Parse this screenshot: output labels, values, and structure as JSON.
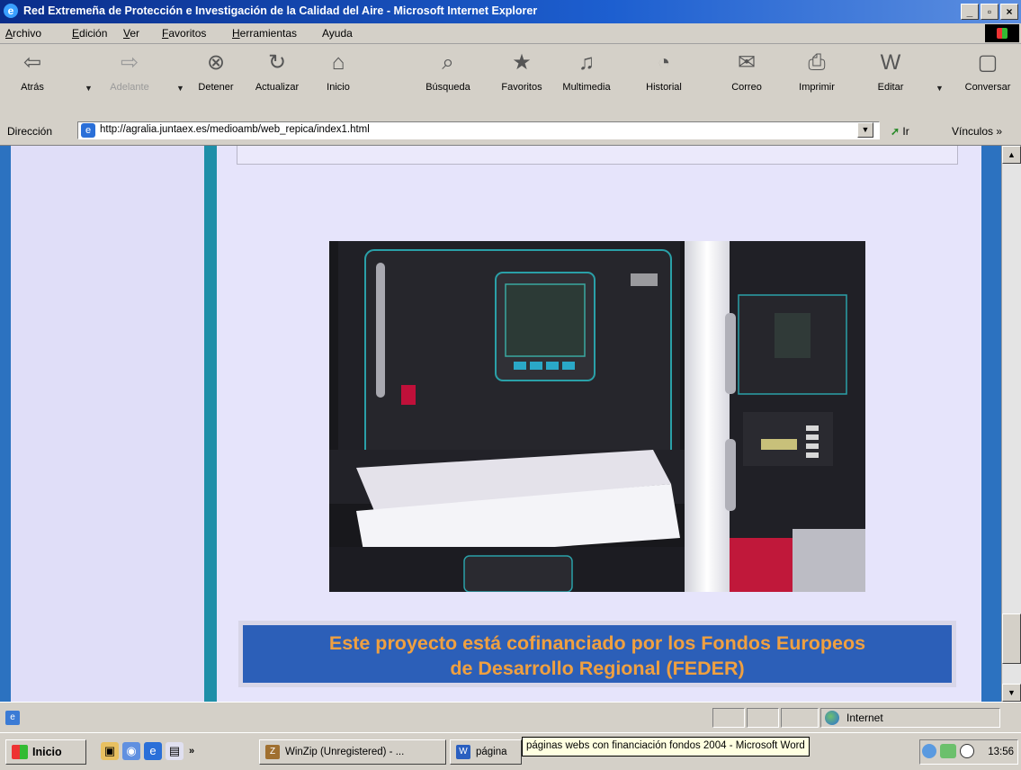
{
  "window": {
    "title": "Red Extremeña de Protección e Investigación de la Calidad del Aire - Microsoft Internet Explorer",
    "controls": {
      "minimize": "_",
      "maximize": "▫",
      "close": "×"
    }
  },
  "menu": {
    "items": [
      {
        "key": "A",
        "rest": "rchivo"
      },
      {
        "key": "E",
        "rest": "dición"
      },
      {
        "key": "V",
        "rest": "er"
      },
      {
        "key": "F",
        "rest": "avoritos"
      },
      {
        "key": "H",
        "rest": "erramientas"
      },
      {
        "key": "",
        "rest": "Ayuda"
      }
    ]
  },
  "toolbar": {
    "buttons": [
      {
        "label": "Atrás",
        "icon": "back-arrow-icon",
        "glyph": "⇦"
      },
      {
        "label": "Adelante",
        "icon": "forward-arrow-icon",
        "glyph": "⇨"
      },
      {
        "label": "Detener",
        "icon": "stop-icon",
        "glyph": "⊗"
      },
      {
        "label": "Actualizar",
        "icon": "refresh-icon",
        "glyph": "↻"
      },
      {
        "label": "Inicio",
        "icon": "home-icon",
        "glyph": "⌂"
      },
      {
        "label": "Búsqueda",
        "icon": "search-icon",
        "glyph": "⌕"
      },
      {
        "label": "Favoritos",
        "icon": "favorites-icon",
        "glyph": "★"
      },
      {
        "label": "Multimedia",
        "icon": "media-icon",
        "glyph": "♫"
      },
      {
        "label": "Historial",
        "icon": "history-icon",
        "glyph": "◔"
      },
      {
        "label": "Correo",
        "icon": "mail-icon",
        "glyph": "✉"
      },
      {
        "label": "Imprimir",
        "icon": "print-icon",
        "glyph": "⎙"
      },
      {
        "label": "Editar",
        "icon": "edit-icon",
        "glyph": "W"
      },
      {
        "label": "Conversar",
        "icon": "discuss-icon",
        "glyph": "▢"
      }
    ]
  },
  "address": {
    "label": "Dirección",
    "url": "http://agralia.juntaex.es/medioamb/web_repica/index1.html",
    "go_label": "Ir",
    "links_label": "Vínculos »"
  },
  "page": {
    "banner_line1": "Este proyecto está cofinanciado por los Fondos Europeos",
    "banner_line2": "de Desarrollo Regional (FEDER)"
  },
  "status": {
    "zone": "Internet"
  },
  "taskbar": {
    "start_label": "Inicio",
    "tasks": [
      {
        "label": "WinZip (Unregistered) - ..."
      },
      {
        "label": "página"
      }
    ],
    "tooltip": "páginas webs con financiación fondos 2004 - Microsoft Word",
    "clock": "13:56"
  },
  "colors": {
    "banner_bg": "#2c5fb8",
    "banner_text": "#f0a040",
    "content_bg": "#e6e4fb"
  }
}
